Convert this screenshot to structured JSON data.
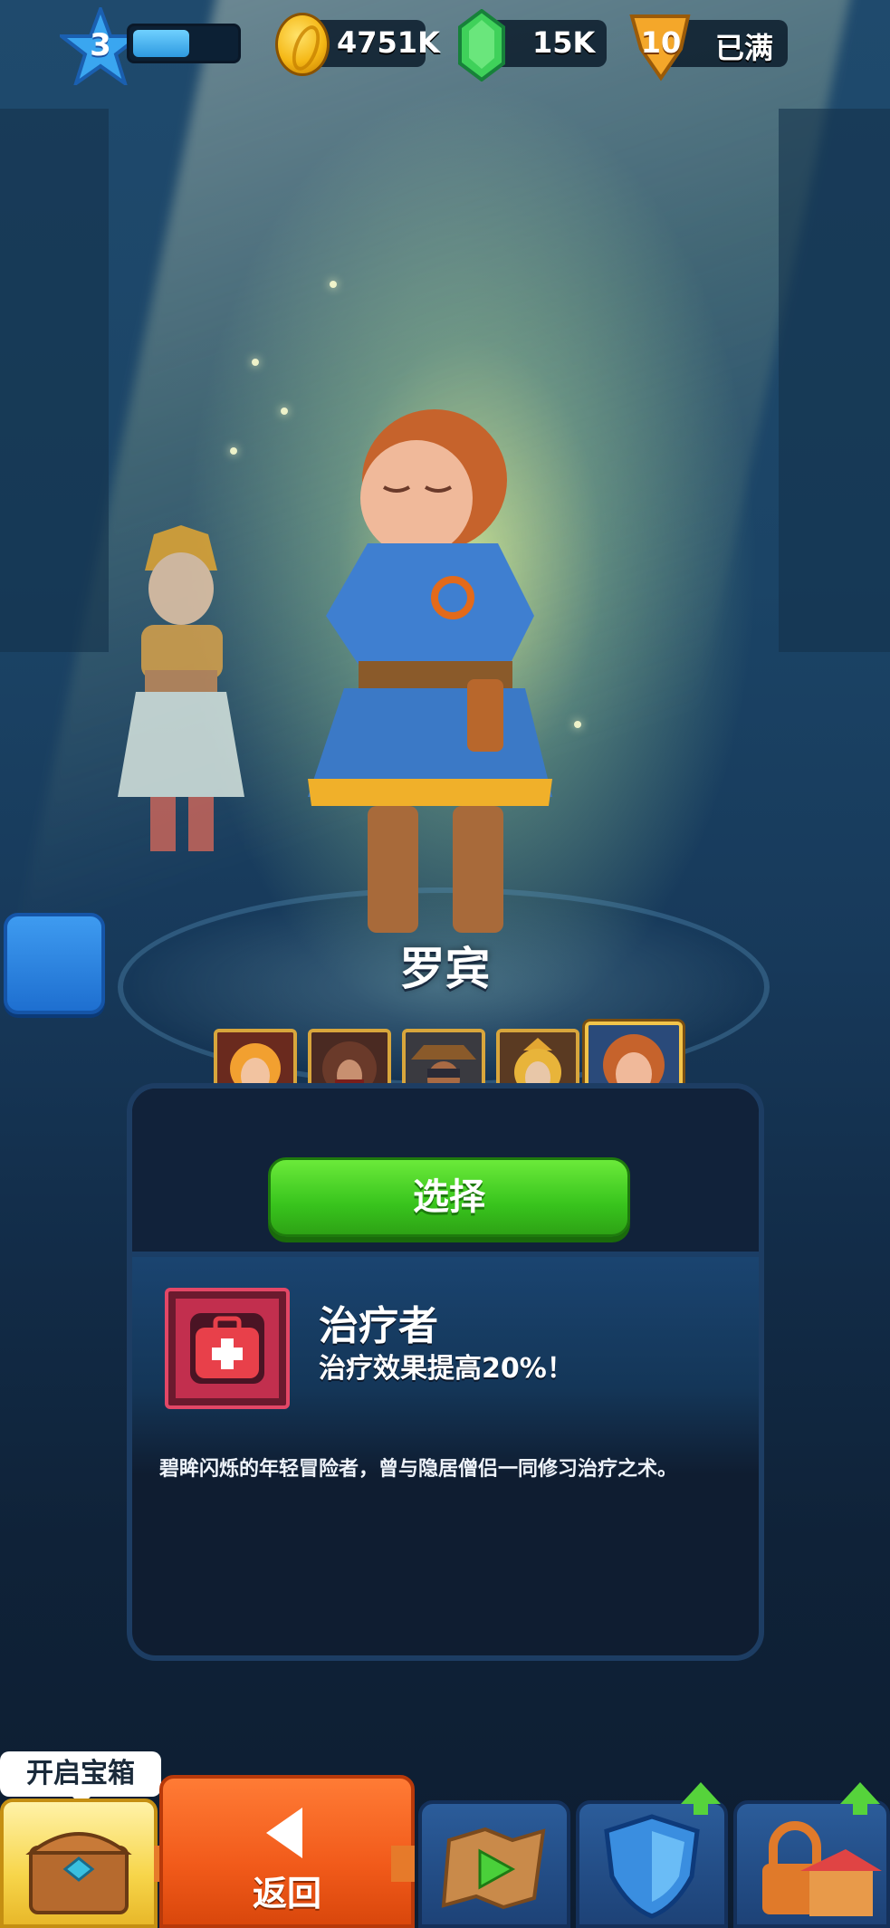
{
  "topbar": {
    "level": "3",
    "xp_fraction": 0.55,
    "coins": "4751K",
    "gems": "15K",
    "tickets": "10",
    "tickets_status": "已满"
  },
  "hero": {
    "name": "罗宾",
    "portrait_count": 5,
    "selected_portrait_index": 4
  },
  "panel": {
    "select_label": "选择",
    "skill_title": "治疗者",
    "skill_desc": "治疗效果提高20%！",
    "lore": "碧眸闪烁的年轻冒险者，曾与隐居僧侣一同修习治疗之术。"
  },
  "bottom_nav": {
    "chest_label": "开启宝箱",
    "back_label": "返回"
  },
  "colors": {
    "accent_green": "#38c41d",
    "back_orange": "#f15a1a",
    "skill_red": "#c22f4e"
  }
}
